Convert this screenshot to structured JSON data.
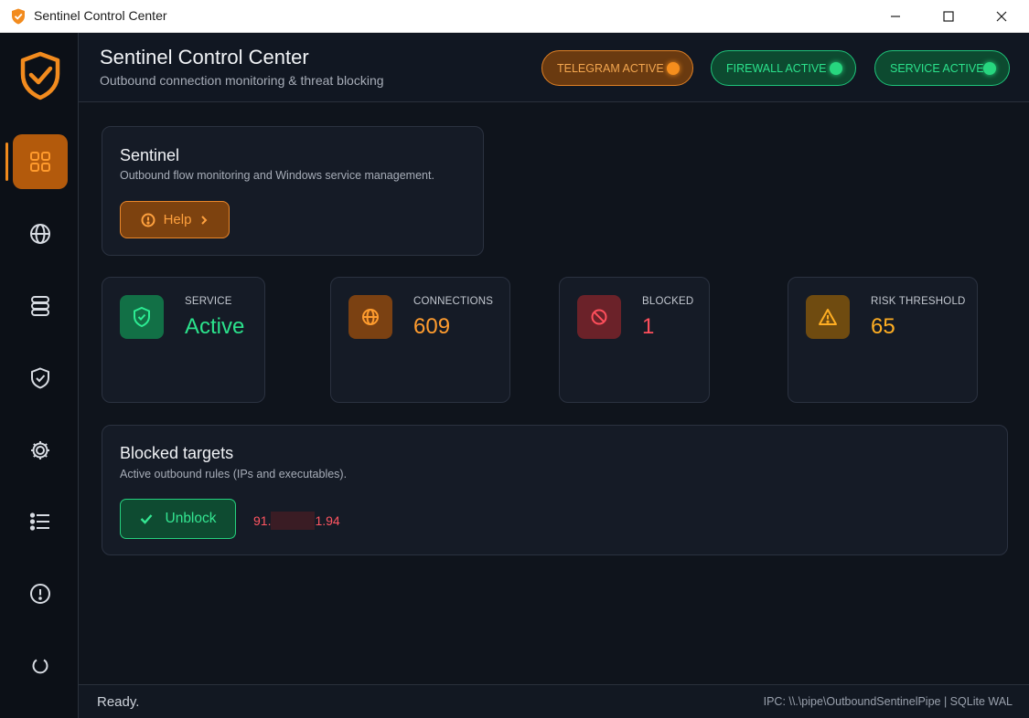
{
  "window": {
    "title": "Sentinel Control Center",
    "minimize_icon": "minimize-icon",
    "maximize_icon": "maximize-icon",
    "close_icon": "close-icon"
  },
  "sidebar": {
    "logo_icon": "shield-check-logo",
    "items": [
      {
        "name": "dashboard",
        "icon": "grid-icon",
        "active": true
      },
      {
        "name": "network",
        "icon": "globe-icon",
        "active": false
      },
      {
        "name": "database",
        "icon": "database-icon",
        "active": false
      },
      {
        "name": "protection",
        "icon": "shield-check-icon",
        "active": false
      },
      {
        "name": "settings",
        "icon": "gear-icon",
        "active": false
      },
      {
        "name": "logs",
        "icon": "list-icon",
        "active": false
      },
      {
        "name": "about",
        "icon": "info-icon",
        "active": false
      },
      {
        "name": "power",
        "icon": "power-icon",
        "active": false
      }
    ]
  },
  "header": {
    "title": "Sentinel Control Center",
    "subtitle": "Outbound connection monitoring & threat blocking",
    "badges": [
      {
        "label": "TELEGRAM ACTIVE",
        "color": "#f58e1d"
      },
      {
        "label": "FIREWALL ACTIVE",
        "color": "#27d67f"
      },
      {
        "label": "SERVICE ACTIVE",
        "color": "#27d67f"
      }
    ]
  },
  "intro": {
    "title": "Sentinel",
    "description": "Outbound flow monitoring and Windows service management.",
    "help_label": "Help"
  },
  "stats": [
    {
      "label": "SERVICE",
      "value": "Active",
      "color": "#2be28c",
      "icon": "shield-check-icon"
    },
    {
      "label": "CONNECTIONS",
      "value": "609",
      "color": "#ff9c2e",
      "icon": "globe-icon"
    },
    {
      "label": "BLOCKED",
      "value": "1",
      "color": "#ff4f5c",
      "icon": "ban-icon"
    },
    {
      "label": "RISK THRESHOLD",
      "value": "65",
      "color": "#ffae22",
      "icon": "warning-icon"
    }
  ],
  "blocked_targets": {
    "title": "Blocked targets",
    "description": "Active outbound rules (IPs and executables).",
    "unblock_label": "Unblock",
    "entries": [
      {
        "ip_prefix": "91.",
        "ip_suffix": "1.94"
      }
    ]
  },
  "statusbar": {
    "status": "Ready.",
    "ipc": "IPC: \\\\.\\pipe\\OutboundSentinelPipe | SQLite WAL"
  }
}
